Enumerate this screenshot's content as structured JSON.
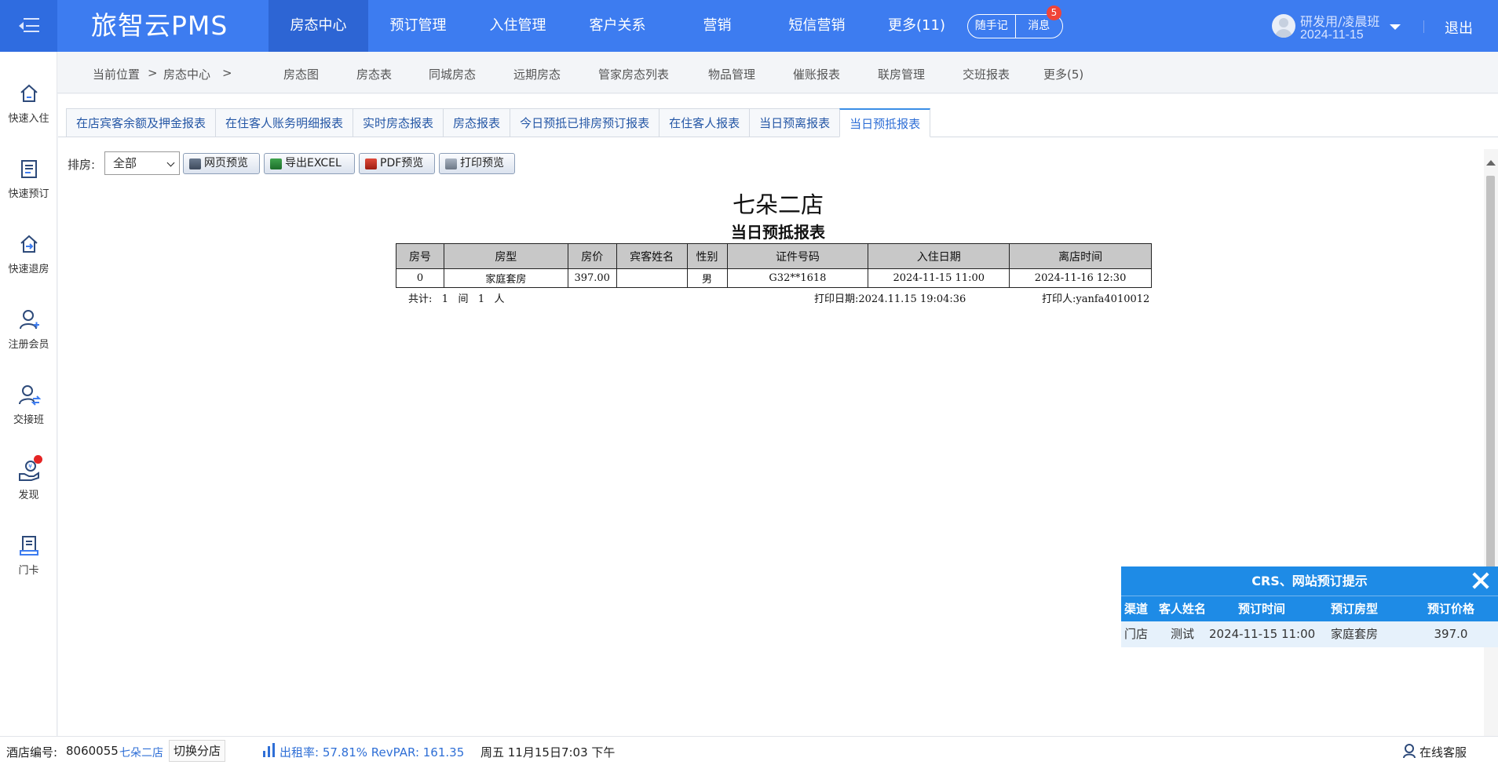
{
  "app": {
    "brand": "旅智云PMS",
    "menu_icon": "hamburger-icon"
  },
  "top_nav": [
    {
      "label": "房态中心",
      "active": true
    },
    {
      "label": "预订管理"
    },
    {
      "label": "入住管理"
    },
    {
      "label": "客户关系"
    },
    {
      "label": "营销"
    },
    {
      "label": "短信营销"
    },
    {
      "label": "更多(11)"
    }
  ],
  "header": {
    "note_label": "随手记",
    "message_label": "消息",
    "message_count": "5",
    "user_name": "研发用/凌晨班",
    "user_date": "2024-11-15",
    "logout_label": "退出"
  },
  "sidebar": [
    {
      "label": "快速入住",
      "icon": "home-icon"
    },
    {
      "label": "快速预订",
      "icon": "document-icon"
    },
    {
      "label": "快速退房",
      "icon": "checkout-icon"
    },
    {
      "label": "注册会员",
      "icon": "add-user-icon"
    },
    {
      "label": "交接班",
      "icon": "shift-handover-icon"
    },
    {
      "label": "发现",
      "icon": "discover-icon"
    },
    {
      "label": "门卡",
      "icon": "card-icon"
    }
  ],
  "breadcrumb": {
    "location_label": "当前位置",
    "sep": ">",
    "current": "房态中心"
  },
  "sub_nav": [
    "房态图",
    "房态表",
    "同城房态",
    "远期房态",
    "管家房态列表",
    "物品管理",
    "催账报表",
    "联房管理",
    "交班报表",
    "更多(5)"
  ],
  "tabs": [
    {
      "label": "在店宾客余额及押金报表"
    },
    {
      "label": "在住客人账务明细报表"
    },
    {
      "label": "实时房态报表"
    },
    {
      "label": "房态报表"
    },
    {
      "label": "今日预抵已排房预订报表"
    },
    {
      "label": "在住客人报表"
    },
    {
      "label": "当日预离报表"
    },
    {
      "label": "当日预抵报表",
      "active": true
    }
  ],
  "toolbar": {
    "room_label": "排房:",
    "room_select_value": "全部",
    "web_preview": "网页预览",
    "export_excel": "导出EXCEL",
    "pdf_preview": "PDF预览",
    "print_preview": "打印预览"
  },
  "report": {
    "shop_name": "七朵二店",
    "title": "当日预抵报表",
    "columns": [
      "房号",
      "房型",
      "房价",
      "宾客姓名",
      "性别",
      "证件号码",
      "入住日期",
      "离店时间"
    ],
    "rows": [
      [
        "0",
        "家庭套房",
        "397.00",
        "",
        "男",
        "G32**1618",
        "2024-11-15 11:00",
        "2024-11-16 12:30"
      ]
    ],
    "footer_total": "共计:   1   间   1   人",
    "footer_print_date": "打印日期:2024.11.15 19:04:36",
    "footer_printer": "打印人:yanfa4010012"
  },
  "popup": {
    "title": "CRS、网站预订提示",
    "columns": [
      "渠道",
      "客人姓名",
      "预订时间",
      "预订房型",
      "预订价格"
    ],
    "row": [
      "门店",
      "测试",
      "2024-11-15 11:00",
      "家庭套房",
      "397.0"
    ]
  },
  "status_bar": {
    "hotel_no_label": "酒店编号:",
    "hotel_no": "8060055",
    "hotel_name": "七朵二店",
    "switch_branch": "切换分店",
    "occupancy": "出租率: 57.81% RevPAR: 161.35",
    "datetime": "周五 11月15日7:03 下午",
    "online_service": "在线客服"
  }
}
